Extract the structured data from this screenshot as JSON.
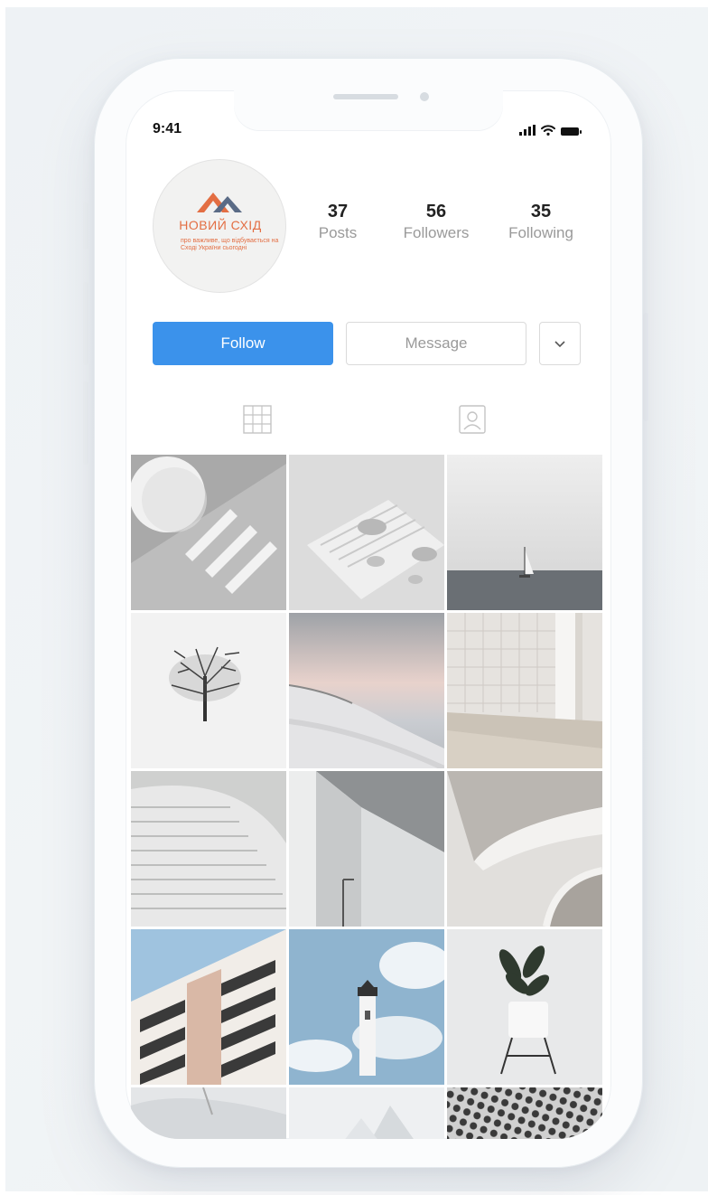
{
  "status_bar": {
    "time": "9:41"
  },
  "profile": {
    "avatar": {
      "brand": "НОВИЙ СХІД",
      "tagline": "про важливе, що відбувається на Сході України сьогодні"
    },
    "stats": [
      {
        "value": "37",
        "label": "Posts"
      },
      {
        "value": "56",
        "label": "Followers"
      },
      {
        "value": "35",
        "label": "Following"
      }
    ]
  },
  "actions": {
    "follow": "Follow",
    "message": "Message"
  },
  "tabs": [
    {
      "icon": "grid-icon"
    },
    {
      "icon": "tagged-person-icon"
    }
  ],
  "colors": {
    "accent": "#3b92eb",
    "brand": "#e36e43"
  },
  "posts": [
    {
      "subject": "sphere and stairs"
    },
    {
      "subject": "zen stones"
    },
    {
      "subject": "sailboat at sea"
    },
    {
      "subject": "lone tree in snow"
    },
    {
      "subject": "snowy hill at dusk"
    },
    {
      "subject": "white tiled interior"
    },
    {
      "subject": "curved staircase"
    },
    {
      "subject": "concrete building"
    },
    {
      "subject": "abstract curves"
    },
    {
      "subject": "apartment facade"
    },
    {
      "subject": "lighthouse"
    },
    {
      "subject": "potted plant"
    },
    {
      "subject": "snow texture"
    },
    {
      "subject": "mountain peak"
    },
    {
      "subject": "geometric pattern"
    }
  ]
}
